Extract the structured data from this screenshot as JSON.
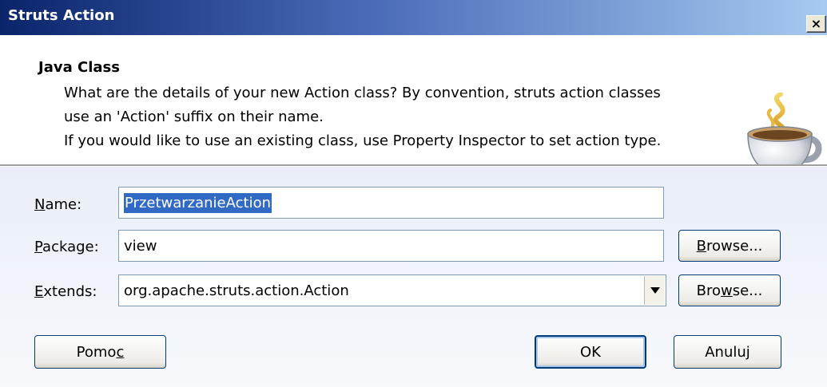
{
  "window": {
    "title": "Struts Action",
    "close_label": "×"
  },
  "header": {
    "title": "Java Class",
    "desc_lines": [
      "What are the details of your new Action class? By convention, struts action classes",
      "use an 'Action' suffix on their name.",
      "If you would like to use an existing class, use Property Inspector to set action type."
    ],
    "icon": "java-cup-icon"
  },
  "form": {
    "name": {
      "label_ul": "N",
      "label_rest": "ame:",
      "value": "PrzetwarzanieAction"
    },
    "package": {
      "label_ul": "P",
      "label_rest": "ackage:",
      "value": "view",
      "browse_pre": "",
      "browse_ul": "B",
      "browse_post": "rowse..."
    },
    "extends": {
      "label_ul": "E",
      "label_rest": "xtends:",
      "value": "org.apache.struts.action.Action",
      "browse_pre": "Bro",
      "browse_ul": "w",
      "browse_post": "se..."
    }
  },
  "buttons": {
    "help_pre": "Pomo",
    "help_ul": "c",
    "ok": "OK",
    "cancel": "Anuluj"
  },
  "colors": {
    "titlebar_start": "#0a246a",
    "selection": "#316ac5"
  }
}
